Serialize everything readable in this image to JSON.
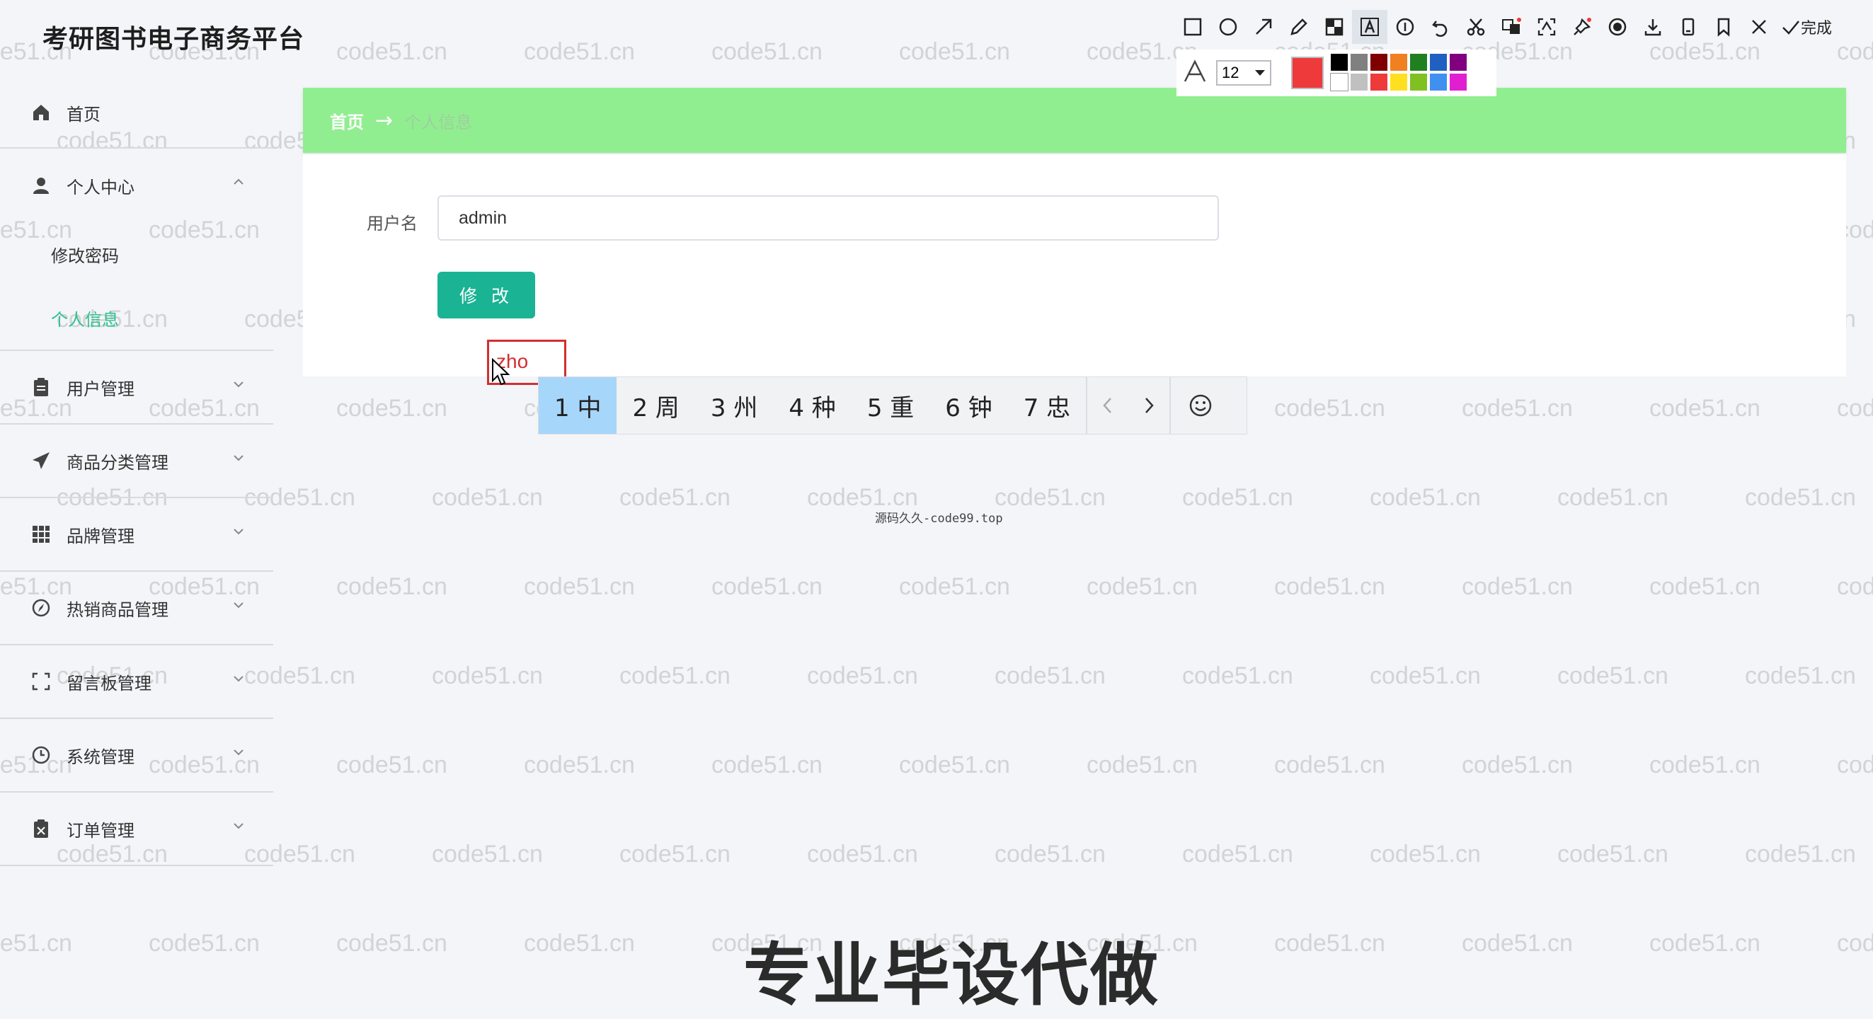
{
  "app": {
    "title": "考研图书电子商务平台"
  },
  "sidebar": {
    "home": "首页",
    "personal_center": {
      "label": "个人中心",
      "children": [
        "修改密码",
        "个人信息"
      ]
    },
    "items": [
      "用户管理",
      "商品分类管理",
      "品牌管理",
      "热销商品管理",
      "留言板管理",
      "系统管理",
      "订单管理"
    ]
  },
  "breadcrumb": {
    "home": "首页",
    "separator": "→",
    "current": "个人信息"
  },
  "form": {
    "username_label": "用户名",
    "username_value": "admin",
    "submit_label": "修 改"
  },
  "annotation": {
    "text_box_value": "zho",
    "font_size": "12",
    "current_color": "#ee3a3a",
    "palette": [
      "#000000",
      "#808080",
      "#800000",
      "#f08020",
      "#208020",
      "#2060c0",
      "#800080",
      "#ffffff",
      "#c0c0c0",
      "#ee3a3a",
      "#ffe020",
      "#80c020",
      "#4090f0",
      "#e020d0"
    ],
    "done_label": "完成",
    "tools": [
      "rectangle-icon",
      "ellipse-icon",
      "arrow-icon",
      "pencil-icon",
      "mosaic-icon",
      "text-icon",
      "number-icon",
      "undo-icon",
      "scissors-icon",
      "translate-icon",
      "ocr-icon",
      "pin-icon",
      "record-icon",
      "download-icon",
      "save-icon",
      "bookmark-icon",
      "close-icon",
      "check-icon"
    ]
  },
  "ime": {
    "candidates": [
      "1 中",
      "2 周",
      "3 州",
      "4 种",
      "5 重",
      "6 钟",
      "7 忠"
    ]
  },
  "overlay": {
    "watermark": "code51.cn",
    "footer_note": "源码久久-code99.top",
    "promo": "专业毕设代做"
  }
}
